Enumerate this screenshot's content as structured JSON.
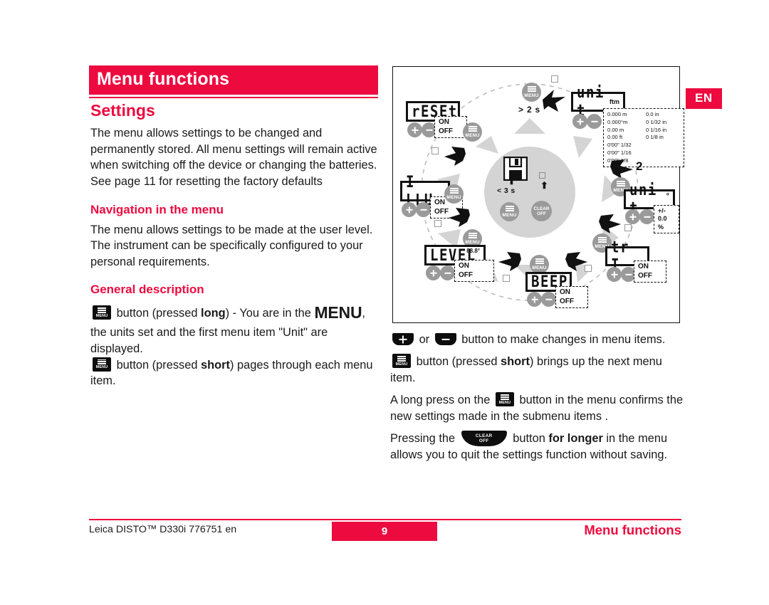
{
  "lang_badge": "EN",
  "header": {
    "title": "Menu functions"
  },
  "left": {
    "h2_settings": "Settings",
    "settings_body": "The menu allows settings to be changed and permanently stored. All menu settings will remain active when switching off the device or changing the batteries. See page 11 for resetting the factory defaults",
    "h3_navigation": "Navigation in the menu",
    "navigation_body": "The menu allows settings to be made at the user level. The instrument can be specifically configured to your personal requirements.",
    "h3_general": "General description",
    "desc1_pre": "button (pressed ",
    "desc1_bold": "long",
    "desc1_mid": ") - You are in the ",
    "desc1_menu": "MENU",
    "desc1_post": ", the units set and the first menu item \"Unit\" are displayed.",
    "desc2_pre": "button (pressed ",
    "desc2_bold": "short",
    "desc2_post": ") pages through each menu item."
  },
  "right": {
    "p1_or": "or",
    "p1_post": "button to make changes in menu items.",
    "p2_pre": "button (pressed ",
    "p2_bold": "short",
    "p2_post": ") brings up the next menu item.",
    "p3_pre": "A long press on the",
    "p3_post": "button in the menu confirms the new settings made in the submenu items .",
    "p4_pre": "Pressing the",
    "p4_mid": "button ",
    "p4_bold": "for longer",
    "p4_post": " in the menu allows you to quit the settings function without saving."
  },
  "icons": {
    "menu_label": "MENU",
    "clear_line1": "CLEAR",
    "clear_line2": "OFF"
  },
  "diagram": {
    "hold_label": "> 2 s",
    "save_hold_label": "< 3 s",
    "step_number": "2",
    "on_label": "ON",
    "off_label": "OFF",
    "nodes": {
      "reset": {
        "display": "rESEt",
        "options": [
          "ON",
          "OFF"
        ]
      },
      "illu": {
        "display": "I LLU",
        "options": [
          "ON",
          "OFF"
        ]
      },
      "level": {
        "display": "LEVEL",
        "badge": "88.8°",
        "options": [
          "ON",
          "OFF"
        ]
      },
      "beep": {
        "display": "BEEP",
        "options": [
          "ON",
          "OFF"
        ]
      },
      "tilt": {
        "display": "tr I",
        "options": [
          "ON",
          "OFF"
        ]
      },
      "unit_angle": {
        "display": "uni t",
        "suffix": "°",
        "options": [
          "+/- 0.0",
          "%"
        ]
      },
      "unit_dist": {
        "display": "uni t",
        "suffix": "ftm"
      }
    },
    "unit_table": [
      "0.000 m",
      "0.0 in",
      "0.000°m",
      "0 1/32 in",
      "0.00 m",
      "0 1/16 in",
      "0.00 ft",
      "0 1/8 in",
      "0'00\" 1/32",
      "",
      "0'00\" 1/16",
      "",
      "0'00\" 1/8",
      ""
    ]
  },
  "footer": {
    "left": "Leica DISTO™ D330i 776751 en",
    "page": "9",
    "right": "Menu functions"
  },
  "colors": {
    "accent": "#ED0A3F",
    "grey_button": "#9A9A9A",
    "hub": "#D4D4D4"
  }
}
